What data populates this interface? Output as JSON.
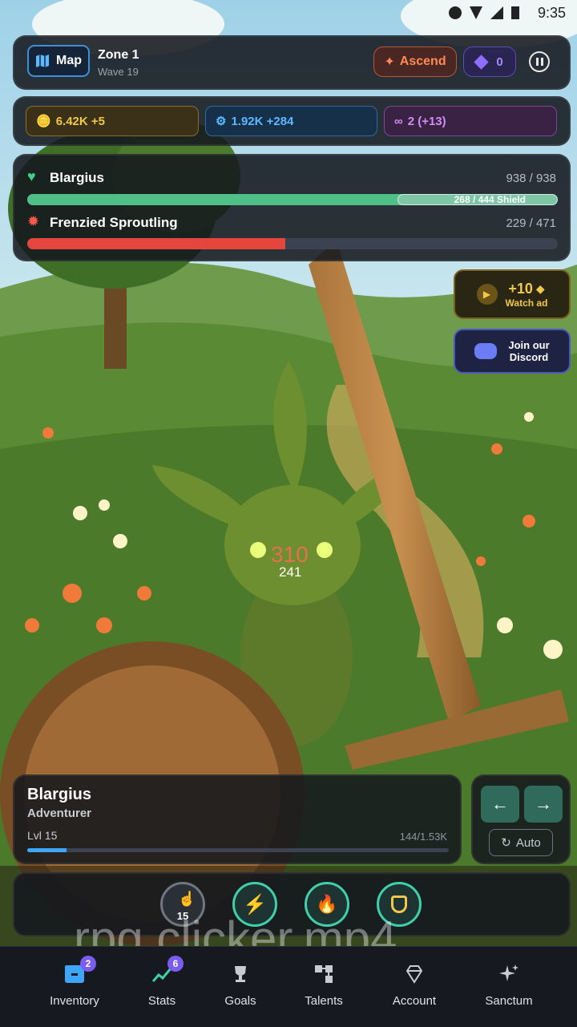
{
  "status_bar": {
    "time": "9:35"
  },
  "header": {
    "map_label": "Map",
    "zone": "Zone 1",
    "wave": "Wave 19",
    "ascend_label": "Ascend",
    "gems": "0"
  },
  "resources": [
    {
      "name": "gold",
      "value": "6.42K +5",
      "color": "#f2c84b"
    },
    {
      "name": "gears",
      "value": "1.92K +284",
      "color": "#5cb8ff"
    },
    {
      "name": "infinity",
      "value": "2 (+13)",
      "color": "#d58cf5"
    }
  ],
  "combat": {
    "player": {
      "name": "Blargius",
      "hp": "938 / 938",
      "hp_fraction": 1.0,
      "shield": "268 / 444 Shield",
      "shield_fraction": 0.604
    },
    "enemy": {
      "name": "Frenzied Sproutling",
      "hp": "229 / 471",
      "hp_fraction": 0.486
    }
  },
  "side_buttons": {
    "ad_reward": "+10",
    "ad_label": "Watch ad",
    "discord_label_1": "Join our",
    "discord_label_2": "Discord"
  },
  "damage": {
    "big": "310",
    "small": "241"
  },
  "character": {
    "name": "Blargius",
    "class": "Adventurer",
    "level": "Lvl 15",
    "xp": "144/1.53K",
    "xp_fraction": 0.094
  },
  "controls": {
    "auto_label": "Auto"
  },
  "abilities": {
    "tap_count": "15"
  },
  "watermark": "rpg clicker.mp4",
  "nav": [
    {
      "label": "Inventory",
      "badge": "2",
      "icon": "inventory-icon"
    },
    {
      "label": "Stats",
      "badge": "6",
      "icon": "stats-icon"
    },
    {
      "label": "Goals",
      "icon": "trophy-icon"
    },
    {
      "label": "Talents",
      "icon": "talents-icon"
    },
    {
      "label": "Account",
      "icon": "diamond-icon"
    },
    {
      "label": "Sanctum",
      "icon": "sparkles-icon"
    }
  ]
}
